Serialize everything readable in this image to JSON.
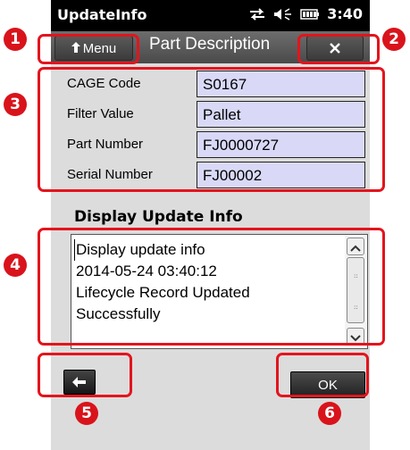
{
  "status_bar": {
    "app_name": "UpdateInfo",
    "time": "3:40",
    "icons": [
      "sync-icon",
      "volume-icon",
      "battery-icon"
    ]
  },
  "title_bar": {
    "menu_label": "Menu",
    "title": "Part Description",
    "close_icon": "close-icon"
  },
  "form": {
    "rows": [
      {
        "label": "CAGE Code",
        "value": "S0167"
      },
      {
        "label": "Filter Value",
        "value": "Pallet"
      },
      {
        "label": "Part Number",
        "value": "FJ0000727"
      },
      {
        "label": "Serial Number",
        "value": "FJ00002"
      }
    ]
  },
  "update_section": {
    "heading": "Display Update Info",
    "lines": [
      "Display update info",
      "2014-05-24 03:40:12",
      "Lifecycle Record Updated",
      "Successfully"
    ]
  },
  "footer": {
    "back_icon": "back-arrow-icon",
    "ok_label": "OK"
  },
  "callouts": [
    "1",
    "2",
    "3",
    "4",
    "5",
    "6"
  ],
  "colors": {
    "callout_red": "#e3141d",
    "field_fill": "#d9d9f7",
    "screen_bg": "#dcdcdc",
    "title_bar": "#555555"
  }
}
